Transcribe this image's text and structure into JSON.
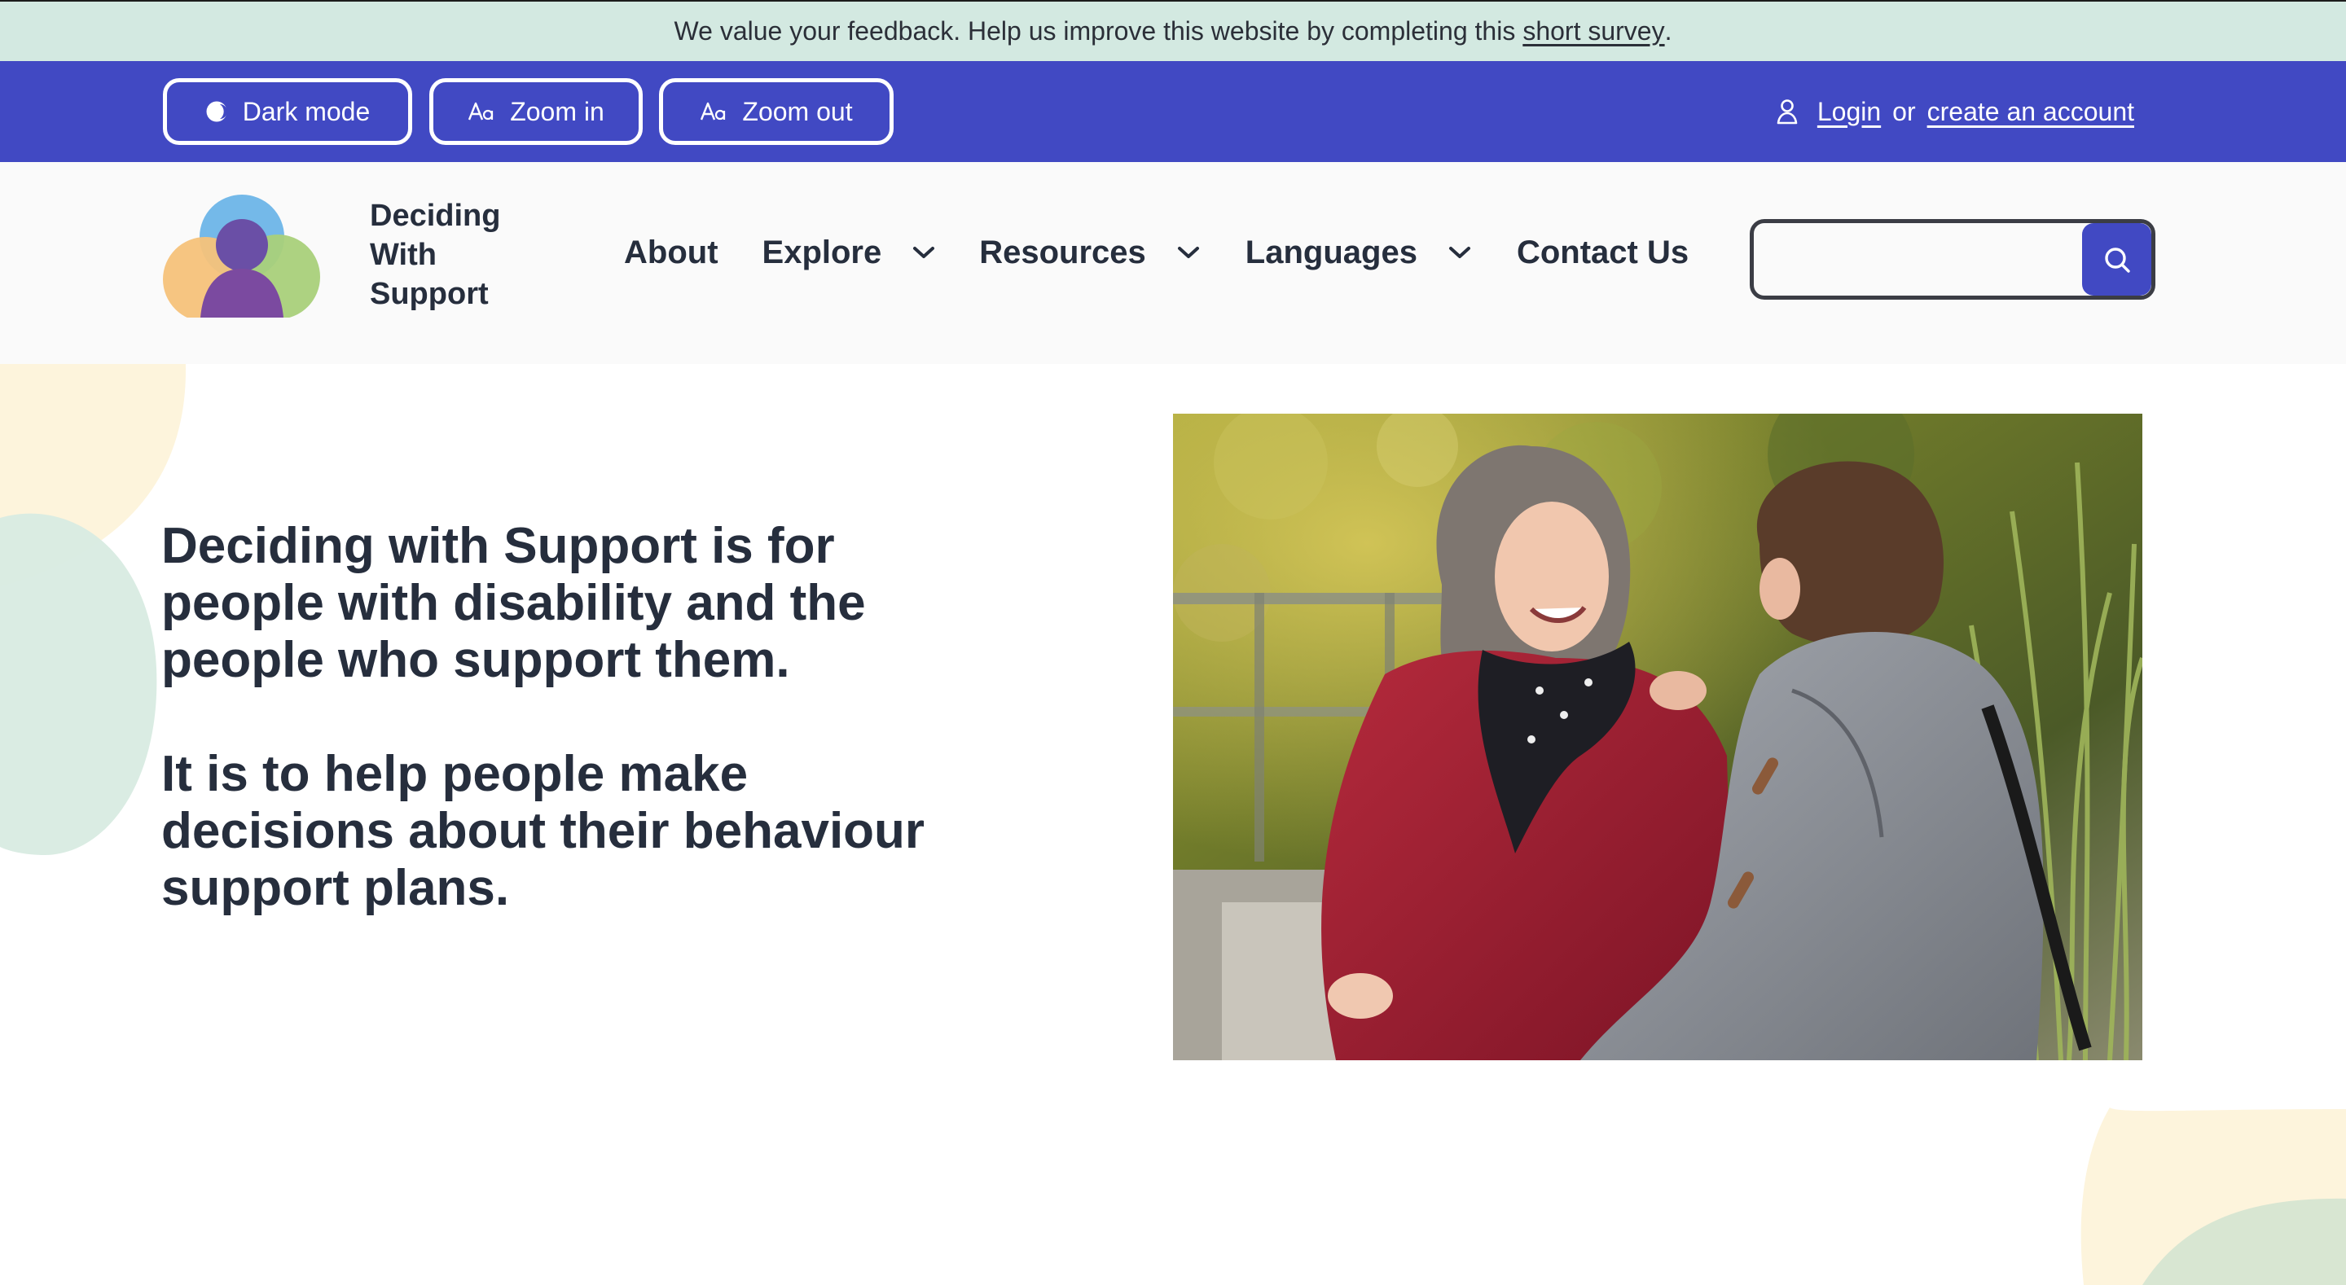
{
  "survey_banner": {
    "text": "We value your feedback. Help us improve this website by completing this",
    "link_label": "short survey",
    "suffix": "."
  },
  "utility_bar": {
    "buttons": [
      {
        "label": "Dark mode",
        "icon": "half-circle-icon"
      },
      {
        "label": "Zoom in",
        "icon": "text-size-icon"
      },
      {
        "label": "Zoom out",
        "icon": "text-size-icon"
      }
    ],
    "login_label": "Login",
    "or_text": "or",
    "create_account_label": "create an account"
  },
  "header": {
    "brand_line1": "Deciding",
    "brand_line2": "With",
    "brand_line3": "Support",
    "nav": [
      {
        "label": "About",
        "has_dropdown": false
      },
      {
        "label": "Explore",
        "has_dropdown": true
      },
      {
        "label": "Resources",
        "has_dropdown": true
      },
      {
        "label": "Languages",
        "has_dropdown": true
      },
      {
        "label": "Contact Us",
        "has_dropdown": false
      }
    ],
    "search": {
      "value": "",
      "placeholder": ""
    }
  },
  "hero": {
    "paragraph1": "Deciding with Support is for people with disability and the people who support them.",
    "paragraph2": "It is to help people make decisions about their behaviour support plans."
  },
  "colors": {
    "brand_blue": "#4149c3",
    "banner_green": "#d3e9e1",
    "text_dark": "#262e3d",
    "header_bg": "#fafafa"
  }
}
